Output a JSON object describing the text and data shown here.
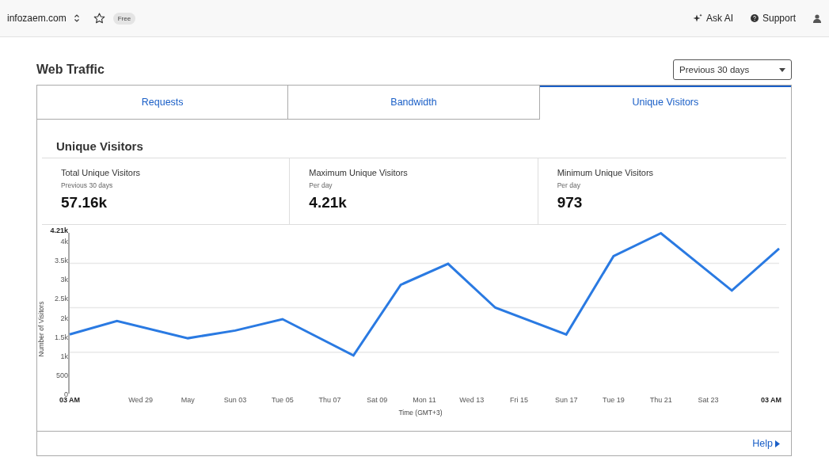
{
  "top_bar": {
    "site": "infozaem.com",
    "plan_badge": "Free",
    "ask_ai": "Ask AI",
    "support": "Support"
  },
  "page": {
    "title": "Web Traffic",
    "range": "Previous 30 days"
  },
  "tabs": [
    {
      "label": "Requests",
      "selected": false
    },
    {
      "label": "Bandwidth",
      "selected": false
    },
    {
      "label": "Unique Visitors",
      "selected": true
    }
  ],
  "section": {
    "title": "Unique Visitors",
    "stats": [
      {
        "label": "Total Unique Visitors",
        "sublabel": "Previous 30 days",
        "value": "57.16k"
      },
      {
        "label": "Maximum Unique Visitors",
        "sublabel": "Per day",
        "value": "4.21k"
      },
      {
        "label": "Minimum Unique Visitors",
        "sublabel": "Per day",
        "value": "973"
      }
    ],
    "chart_data": {
      "type": "line",
      "xlabel": "Time (GMT+3)",
      "ylabel": "Number of Visitors",
      "ylim": [
        0,
        4210
      ],
      "categories": [
        "03 AM",
        null,
        null,
        "Wed 29",
        null,
        "May",
        null,
        "Sun 03",
        null,
        "Tue 05",
        null,
        "Thu 07",
        null,
        "Sat 09",
        null,
        "Mon 11",
        null,
        "Wed 13",
        null,
        "Fri 15",
        null,
        "Sun 17",
        null,
        "Tue 19",
        null,
        "Thu 21",
        null,
        "Sat 23",
        null,
        null,
        "03 AM"
      ],
      "series": [
        {
          "color": "#2a7ae2",
          "values": [
            1550,
            null,
            1900,
            null,
            null,
            1450,
            null,
            1650,
            null,
            1950,
            null,
            null,
            1000,
            null,
            2850,
            null,
            3400,
            null,
            2250,
            null,
            null,
            1550,
            null,
            3600,
            null,
            4200,
            null,
            null,
            2700,
            null,
            3800
          ]
        }
      ],
      "yticks": [
        {
          "value": 0,
          "label": "0"
        },
        {
          "value": 500,
          "label": "500"
        },
        {
          "value": 1000,
          "label": "1k"
        },
        {
          "value": 1500,
          "label": "1.5k"
        },
        {
          "value": 2000,
          "label": "2k"
        },
        {
          "value": 2500,
          "label": "2.5k"
        },
        {
          "value": 3000,
          "label": "3k"
        },
        {
          "value": 3500,
          "label": "3.5k"
        },
        {
          "value": 4000,
          "label": "4k"
        },
        {
          "value": 4210,
          "label": "4.21k"
        }
      ]
    }
  },
  "footer": {
    "help": "Help"
  }
}
